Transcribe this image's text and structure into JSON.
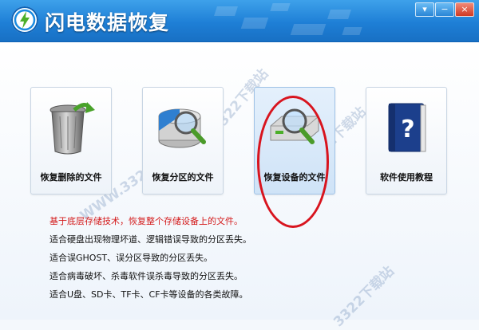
{
  "window": {
    "title": "闪电数据恢复",
    "controls": {
      "menu": "▾",
      "minimize": "−",
      "close": "×"
    }
  },
  "tiles": [
    {
      "label": "恢复删除的文件",
      "icon": "trash-bin-icon"
    },
    {
      "label": "恢复分区的文件",
      "icon": "partition-disk-icon"
    },
    {
      "label": "恢复设备的文件",
      "icon": "device-drive-icon",
      "selected": true
    },
    {
      "label": "软件使用教程",
      "icon": "help-book-icon"
    }
  ],
  "description": [
    "基于底层存储技术，恢复整个存储设备上的文件。",
    "适合硬盘出现物理坏道、逻辑错误导致的分区丢失。",
    "适合误GHOST、误分区导致的分区丢失。",
    "适合病毒破坏、杀毒软件误杀毒导致的分区丢失。",
    "适合U盘、SD卡、TF卡、CF卡等设备的各类故障。"
  ],
  "watermarks": [
    "3322下载站",
    "WWW.3322.CC",
    "3322下载站",
    "3322下载站"
  ],
  "colors": {
    "title_bar": "#1e7fd6",
    "highlight_text": "#d41c1c",
    "annotation": "#d8141e"
  }
}
